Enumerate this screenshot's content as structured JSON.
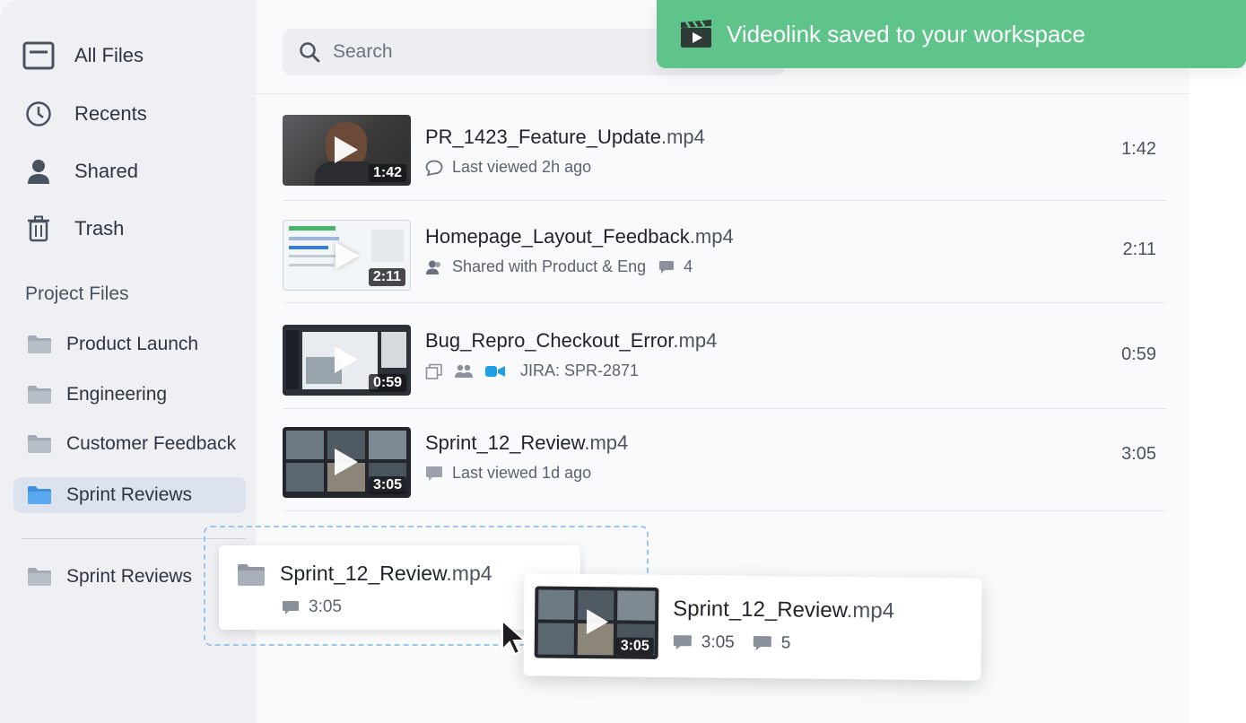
{
  "sidebar": {
    "nav": [
      {
        "label": "All Files",
        "icon": "all-files-icon"
      },
      {
        "label": "Recents",
        "icon": "clock-icon"
      },
      {
        "label": "Shared",
        "icon": "user-icon"
      },
      {
        "label": "Trash",
        "icon": "trash-icon"
      }
    ],
    "section_title": "Project Files",
    "folders": [
      {
        "label": "Product Launch",
        "active": false
      },
      {
        "label": "Engineering",
        "active": false
      },
      {
        "label": "Customer Feedback",
        "active": false
      },
      {
        "label": "Sprint Reviews",
        "active": true
      }
    ],
    "extra_folder": "Sprint Reviews"
  },
  "search": {
    "placeholder": "Search"
  },
  "toast": {
    "message": "Videolink saved to your workspace",
    "color": "#5ec48a"
  },
  "files": [
    {
      "name": "PR_1423_Feature_Update",
      "ext": ".mp4",
      "thumb_duration": "1:42",
      "meta": "Last viewed 2h ago",
      "duration": "1:42"
    },
    {
      "name": "Homepage_Layout_Feedback",
      "ext": ".mp4",
      "thumb_duration": "2:11",
      "meta": "Shared with Product & Eng",
      "comments": "4",
      "duration": "2:11"
    },
    {
      "name": "Bug_Repro_Checkout_Error",
      "ext": ".mp4",
      "thumb_duration": "0:59",
      "meta": "JIRA: SPR-2871",
      "duration": "0:59"
    },
    {
      "name": "Sprint_12_Review",
      "ext": ".mp4",
      "thumb_duration": "3:05",
      "meta": "Last viewed 1d ago",
      "duration": "3:05"
    }
  ],
  "drag": {
    "card1": {
      "name": "Sprint_12_Review",
      "ext": ".mp4",
      "duration": "3:05"
    },
    "card2": {
      "name": "Sprint_12_Review",
      "ext": ".mp4",
      "thumb_duration": "3:05",
      "duration": "3:05",
      "comments": "5"
    }
  }
}
